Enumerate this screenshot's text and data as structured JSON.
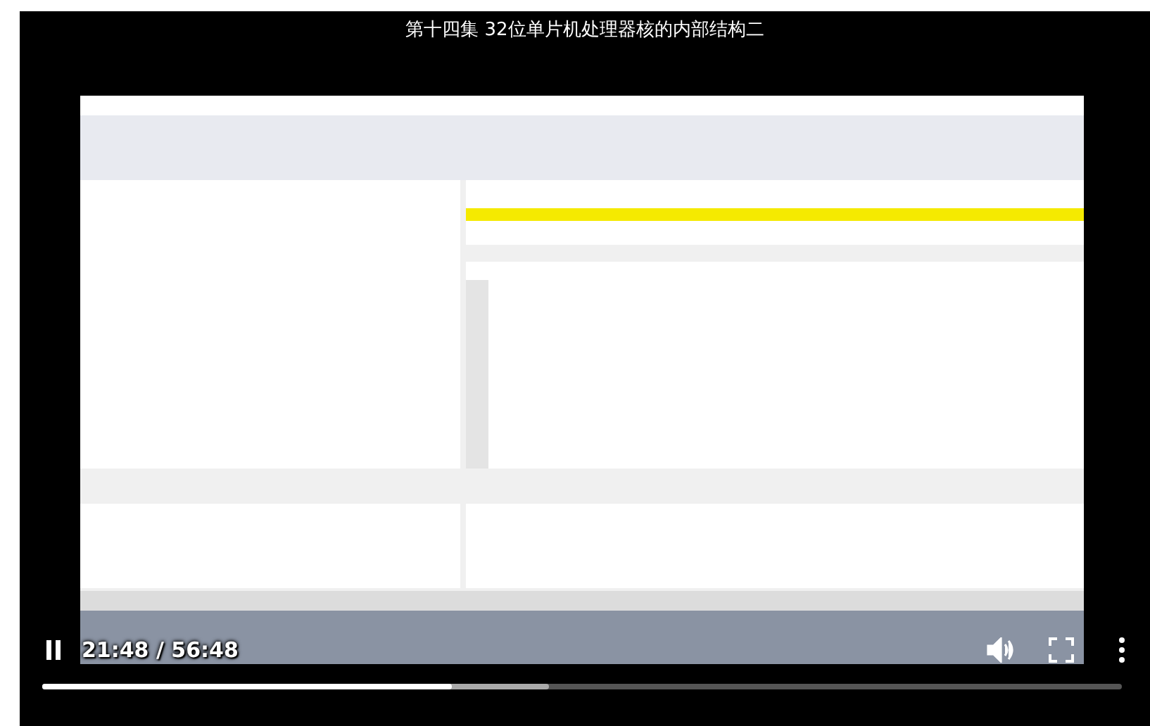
{
  "video": {
    "title": "第十四集 32位单片机处理器核的内部结构二",
    "kind": "picture"
  },
  "controls": {
    "playing": true,
    "time": "21:48 / 56:48",
    "progress": {
      "level": 0.38
    },
    "buffer": {
      "level": 0.47
    }
  }
}
